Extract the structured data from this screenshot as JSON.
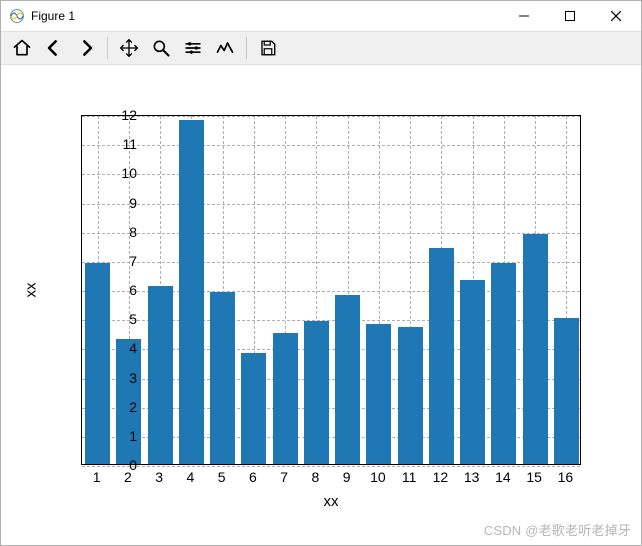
{
  "window": {
    "title": "Figure 1"
  },
  "toolbar": {
    "home": "Home",
    "back": "Back",
    "forward": "Forward",
    "pan": "Pan",
    "zoom": "Zoom",
    "subplots": "Configure subplots",
    "edit": "Edit",
    "save": "Save"
  },
  "watermark": "CSDN @老歌老听老掉牙",
  "chart_data": {
    "type": "bar",
    "categories": [
      "1",
      "2",
      "3",
      "4",
      "5",
      "6",
      "7",
      "8",
      "9",
      "10",
      "11",
      "12",
      "13",
      "14",
      "15",
      "16"
    ],
    "values": [
      6.9,
      4.3,
      6.1,
      11.8,
      5.9,
      3.8,
      4.5,
      4.9,
      5.8,
      4.8,
      4.7,
      7.4,
      6.3,
      6.9,
      7.9,
      5.0
    ],
    "xlabel": "xx",
    "ylabel": "xx",
    "ylim": [
      0,
      12
    ],
    "yticks": [
      0,
      1,
      2,
      3,
      4,
      5,
      6,
      7,
      8,
      9,
      10,
      11,
      12
    ],
    "bar_color": "#1f77b4",
    "grid": true
  }
}
